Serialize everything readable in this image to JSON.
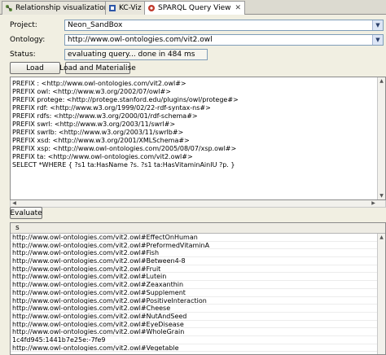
{
  "tabs": [
    {
      "label": "Relationship visualization",
      "icon": "relationship-icon",
      "color": "#5b8a3a",
      "closable": false,
      "active": false
    },
    {
      "label": "KC-Viz",
      "icon": "kcviz-icon",
      "color": "#2d56a8",
      "closable": false,
      "active": false
    },
    {
      "label": "SPARQL Query View",
      "icon": "sparql-icon",
      "color": "#c0392b",
      "closable": true,
      "active": true
    }
  ],
  "form": {
    "project_label": "Project:",
    "project_value": "Neon_SandBox",
    "ontology_label": "Ontology:",
    "ontology_value": "http://www.owl-ontologies.com/vit2.owl",
    "status_label": "Status:",
    "status_value": "evaluating query... done in 484 ms"
  },
  "buttons": {
    "load": "Load",
    "load_materialise": "Load and Materialise",
    "evaluate": "Evaluate"
  },
  "query_lines": [
    "PREFIX : <http://www.owl-ontologies.com/vit2.owl#>",
    "PREFIX owl: <http://www.w3.org/2002/07/owl#>",
    "PREFIX protege: <http://protege.stanford.edu/plugins/owl/protege#>",
    "PREFIX rdf: <http://www.w3.org/1999/02/22-rdf-syntax-ns#>",
    "PREFIX rdfs: <http://www.w3.org/2000/01/rdf-schema#>",
    "PREFIX swrl: <http://www.w3.org/2003/11/swrl#>",
    "PREFIX swrlb: <http://www.w3.org/2003/11/swrlb#>",
    "PREFIX xsd: <http://www.w3.org/2001/XMLSchema#>",
    "PREFIX xsp: <http://www.owl-ontologies.com/2005/08/07/xsp.owl#>",
    "PREFIX ta: <http://www.owl-ontologies.com/vit2.owl#>",
    "SELECT *WHERE { ?s1 ta:HasName ?s. ?s1 ta:HasVitaminAinIU ?p. }"
  ],
  "results": {
    "column": "s",
    "rows": [
      "http://www.owl-ontologies.com/vit2.owl#EffectOnHuman",
      "http://www.owl-ontologies.com/vit2.owl#PreformedVitaminA",
      "http://www.owl-ontologies.com/vit2.owl#Fish",
      "http://www.owl-ontologies.com/vit2.owl#Between4-8",
      "http://www.owl-ontologies.com/vit2.owl#Fruit",
      "http://www.owl-ontologies.com/vit2.owl#Lutein",
      "http://www.owl-ontologies.com/vit2.owl#Zeaxanthin",
      "http://www.owl-ontologies.com/vit2.owl#Supplement",
      "http://www.owl-ontologies.com/vit2.owl#PositiveInteraction",
      "http://www.owl-ontologies.com/vit2.owl#Cheese",
      "http://www.owl-ontologies.com/vit2.owl#NutAndSeed",
      "http://www.owl-ontologies.com/vit2.owl#EyeDisease",
      "http://www.owl-ontologies.com/vit2.owl#WholeGrain",
      "1c4fd945:1441b7e25e:-7fe9",
      "http://www.owl-ontologies.com/vit2.owl#Vegetable"
    ]
  }
}
